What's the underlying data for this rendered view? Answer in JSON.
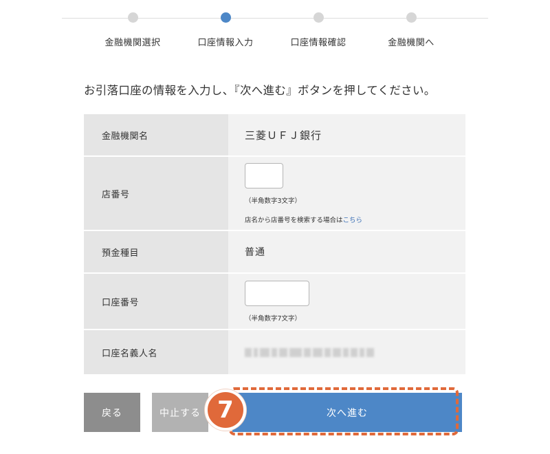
{
  "stepper": {
    "steps": [
      {
        "label": "金融機関選択",
        "active": false
      },
      {
        "label": "口座情報入力",
        "active": true
      },
      {
        "label": "口座情報確認",
        "active": false
      },
      {
        "label": "金融機関へ",
        "active": false
      }
    ]
  },
  "instruction": "お引落口座の情報を入力し、『次へ進む』ボタンを押してください。",
  "form": {
    "bank_name": {
      "label": "金融機関名",
      "value": "三菱ＵＦＪ銀行"
    },
    "branch_number": {
      "label": "店番号",
      "value": "",
      "hint": "（半角数字3文字）",
      "search_text": "店名から店番号を検索する場合は",
      "search_link": "こちら"
    },
    "deposit_type": {
      "label": "預金種目",
      "value": "普通"
    },
    "account_number": {
      "label": "口座番号",
      "value": "",
      "hint": "（半角数字7文字）"
    },
    "account_holder": {
      "label": "口座名義人名",
      "value": ""
    }
  },
  "buttons": {
    "back": "戻る",
    "cancel": "中止する",
    "next": "次へ進む"
  },
  "annotation": {
    "step_number": "7"
  },
  "colors": {
    "accent": "#4d87c7",
    "highlight": "#e0693a"
  }
}
